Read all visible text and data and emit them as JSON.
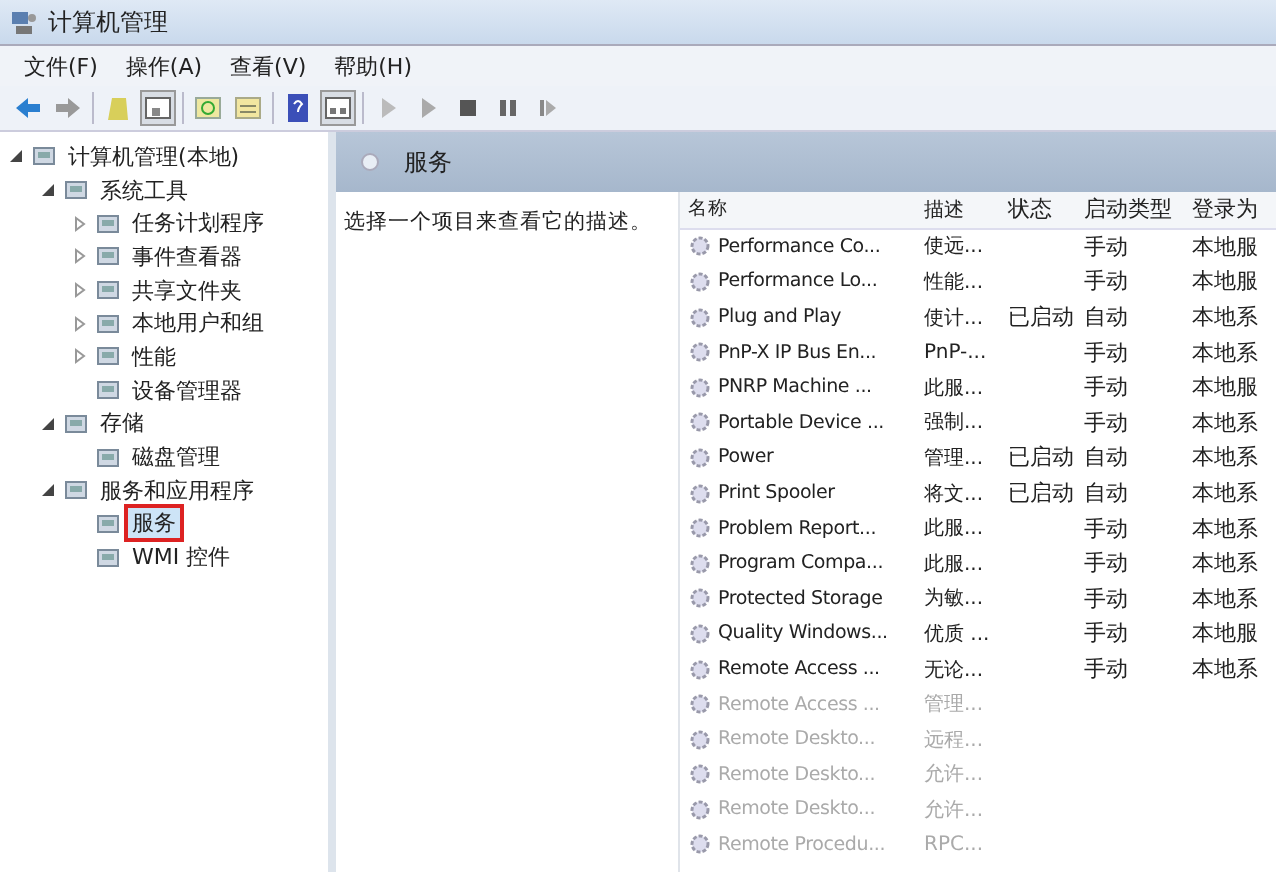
{
  "window": {
    "title": "计算机管理"
  },
  "menu": [
    "文件(F)",
    "操作(A)",
    "查看(V)",
    "帮助(H)"
  ],
  "tree": [
    {
      "label": "计算机管理(本地)",
      "expanded": true,
      "selected": false,
      "children": [
        {
          "label": "系统工具",
          "expanded": true,
          "selected": false,
          "children": [
            {
              "label": "任务计划程序",
              "expanded": false,
              "selected": false
            },
            {
              "label": "事件查看器",
              "expanded": false,
              "selected": false
            },
            {
              "label": "共享文件夹",
              "expanded": false,
              "selected": false
            },
            {
              "label": "本地用户和组",
              "expanded": false,
              "selected": false
            },
            {
              "label": "性能",
              "expanded": false,
              "selected": false
            },
            {
              "label": "设备管理器",
              "selected": false
            }
          ]
        },
        {
          "label": "存储",
          "expanded": true,
          "selected": false,
          "children": [
            {
              "label": "磁盘管理",
              "selected": false
            }
          ]
        },
        {
          "label": "服务和应用程序",
          "expanded": true,
          "selected": false,
          "children": [
            {
              "label": "服务",
              "selected": true
            },
            {
              "label": "WMI 控件",
              "selected": false
            }
          ]
        }
      ]
    }
  ],
  "panel": {
    "title": "服务",
    "description": "选择一个项目来查看它的描述。"
  },
  "table": {
    "columns": [
      "名称",
      "描述",
      "状态",
      "启动类型",
      "登录为"
    ],
    "rows": [
      {
        "name": "Performance Co...",
        "desc": "使远...",
        "status": "",
        "startup": "手动",
        "logon": "本地服",
        "dimmed": false
      },
      {
        "name": "Performance Lo...",
        "desc": "性能...",
        "status": "",
        "startup": "手动",
        "logon": "本地服",
        "dimmed": false
      },
      {
        "name": "Plug and Play",
        "desc": "使计...",
        "status": "已启动",
        "startup": "自动",
        "logon": "本地系",
        "dimmed": false
      },
      {
        "name": "PnP-X IP Bus En...",
        "desc": "PnP-...",
        "status": "",
        "startup": "手动",
        "logon": "本地系",
        "dimmed": false
      },
      {
        "name": "PNRP Machine ...",
        "desc": "此服...",
        "status": "",
        "startup": "手动",
        "logon": "本地服",
        "dimmed": false
      },
      {
        "name": "Portable Device ...",
        "desc": "强制...",
        "status": "",
        "startup": "手动",
        "logon": "本地系",
        "dimmed": false
      },
      {
        "name": "Power",
        "desc": "管理...",
        "status": "已启动",
        "startup": "自动",
        "logon": "本地系",
        "dimmed": false
      },
      {
        "name": "Print Spooler",
        "desc": "将文...",
        "status": "已启动",
        "startup": "自动",
        "logon": "本地系",
        "dimmed": false
      },
      {
        "name": "Problem Report...",
        "desc": "此服...",
        "status": "",
        "startup": "手动",
        "logon": "本地系",
        "dimmed": false
      },
      {
        "name": "Program Compa...",
        "desc": "此服...",
        "status": "",
        "startup": "手动",
        "logon": "本地系",
        "dimmed": false
      },
      {
        "name": "Protected Storage",
        "desc": "为敏...",
        "status": "",
        "startup": "手动",
        "logon": "本地系",
        "dimmed": false
      },
      {
        "name": "Quality Windows...",
        "desc": "优质 ...",
        "status": "",
        "startup": "手动",
        "logon": "本地服",
        "dimmed": false
      },
      {
        "name": "Remote Access ...",
        "desc": "无论...",
        "status": "",
        "startup": "手动",
        "logon": "本地系",
        "dimmed": false
      },
      {
        "name": "Remote Access ...",
        "desc": "管理...",
        "status": "",
        "startup": "",
        "logon": "",
        "dimmed": true
      },
      {
        "name": "Remote Deskto...",
        "desc": "远程...",
        "status": "",
        "startup": "",
        "logon": "",
        "dimmed": true
      },
      {
        "name": "Remote Deskto...",
        "desc": "允许...",
        "status": "",
        "startup": "",
        "logon": "",
        "dimmed": true
      },
      {
        "name": "Remote Deskto...",
        "desc": "允许...",
        "status": "",
        "startup": "",
        "logon": "",
        "dimmed": true
      },
      {
        "name": "Remote Procedu...",
        "desc": "RPC...",
        "status": "",
        "startup": "",
        "logon": "",
        "dimmed": true
      }
    ]
  }
}
